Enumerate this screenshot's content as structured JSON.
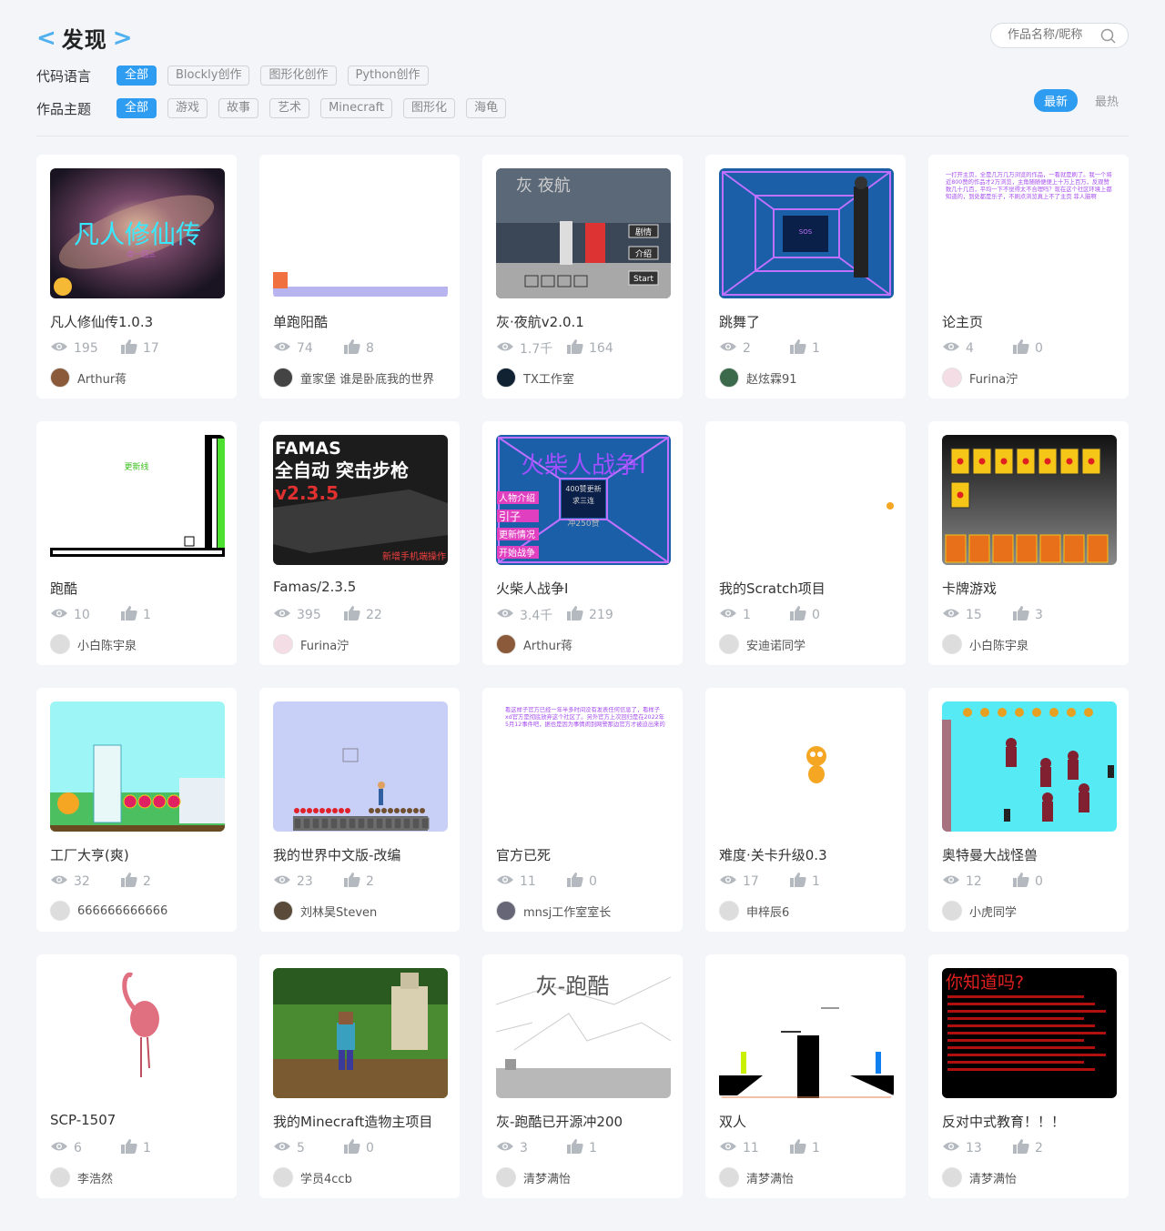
{
  "header": {
    "title": "发现",
    "search_placeholder": "作品名称/昵称"
  },
  "filters": {
    "language": {
      "label": "代码语言",
      "options": [
        "全部",
        "Blockly创作",
        "图形化创作",
        "Python创作"
      ],
      "active": 0
    },
    "theme": {
      "label": "作品主题",
      "options": [
        "全部",
        "游戏",
        "故事",
        "艺术",
        "Minecraft",
        "图形化",
        "海龟"
      ],
      "active": 0
    }
  },
  "sort": {
    "options": [
      "最新",
      "最热"
    ],
    "active": 0
  },
  "colors": {
    "accent": "#2e9cf0",
    "icon_gray": "#b4b9c0"
  },
  "works": [
    {
      "name": "凡人修仙传1.0.3",
      "views": "195",
      "likes": "17",
      "author": "Arthur蒋",
      "thumb_text": "凡人修仙传",
      "thumb_sub": "点一回三"
    },
    {
      "name": "单跑阳酷",
      "views": "74",
      "likes": "8",
      "author": "童家堡 谁是卧底我的世界"
    },
    {
      "name": "灰·夜航v2.0.1",
      "views": "1.7千",
      "likes": "164",
      "author": "TX工作室",
      "thumb_text": "灰 夜航",
      "thumb_buttons": [
        "剧情",
        "介绍",
        "Start"
      ]
    },
    {
      "name": "跳舞了",
      "views": "2",
      "likes": "1",
      "author": "赵炫霖91",
      "thumb_text": "SOS"
    },
    {
      "name": "论主页",
      "views": "4",
      "likes": "0",
      "author": "Furina泞",
      "thumb_text": "一打开主页，全是几万几万浏览的作品，一看就是刷了。我一个将近800赞的作品才2万浏览，主角随随便便上十万上百万，反观赞数几十几百，平均一下不觉得太不合理吗？现在这个社区环境上都知道的，到处都是乐子，不刷点浏览真上不了主页 菲人脑啊"
    },
    {
      "name": "跑酷",
      "views": "10",
      "likes": "1",
      "author": "小白陈宇泉",
      "thumb_text": "更新线"
    },
    {
      "name": "Famas/2.3.5",
      "views": "395",
      "likes": "22",
      "author": "Furina泞",
      "thumb_text": [
        "FAMAS",
        "全自动 突击步枪",
        "v2.3.5",
        "新增手机端操作"
      ]
    },
    {
      "name": "火柴人战争I",
      "views": "3.4千",
      "likes": "219",
      "author": "Arthur蒋",
      "thumb_text": "火柴人战争I",
      "thumb_buttons": [
        "人物介绍",
        "引子",
        "更新情况",
        "开始战争"
      ],
      "thumb_box": [
        "400赞更新",
        "求三连",
        "冲250赞"
      ]
    },
    {
      "name": "我的Scratch项目",
      "views": "1",
      "likes": "0",
      "author": "安迪诺同学"
    },
    {
      "name": "卡牌游戏",
      "views": "15",
      "likes": "3",
      "author": "小白陈宇泉"
    },
    {
      "name": "工厂大亨(爽)",
      "views": "32",
      "likes": "2",
      "author": "666666666666"
    },
    {
      "name": "我的世界中文版-改编",
      "views": "23",
      "likes": "2",
      "author": "刘林昊Steven"
    },
    {
      "name": "官方已死",
      "views": "11",
      "likes": "0",
      "author": "mnsj工作室室长",
      "thumb_text": "看这样子官方已经一年半多时间没有发表任何信息了，看样子xd官方是彻底放弃这个社区了。另外官方上次回归是在2022年5月12事件吧，据也是因为事情闹到网警那边官方才被迫出来的"
    },
    {
      "name": "难度·关卡升级0.3",
      "views": "17",
      "likes": "1",
      "author": "申梓辰6"
    },
    {
      "name": "奥特曼大战怪兽",
      "views": "12",
      "likes": "0",
      "author": "小虎同学"
    },
    {
      "name": "SCP-1507",
      "views": "6",
      "likes": "1",
      "author": "李浩然"
    },
    {
      "name": "我的Minecraft造物主项目",
      "views": "5",
      "likes": "0",
      "author": "学员4ccb"
    },
    {
      "name": "灰-跑酷已开源冲200",
      "views": "3",
      "likes": "1",
      "author": "清梦满怡",
      "thumb_text": "灰-跑酷"
    },
    {
      "name": "双人",
      "views": "11",
      "likes": "1",
      "author": "清梦满怡"
    },
    {
      "name": "反对中式教育！！！",
      "views": "13",
      "likes": "2",
      "author": "清梦满怡",
      "thumb_text": "你知道吗?"
    }
  ]
}
